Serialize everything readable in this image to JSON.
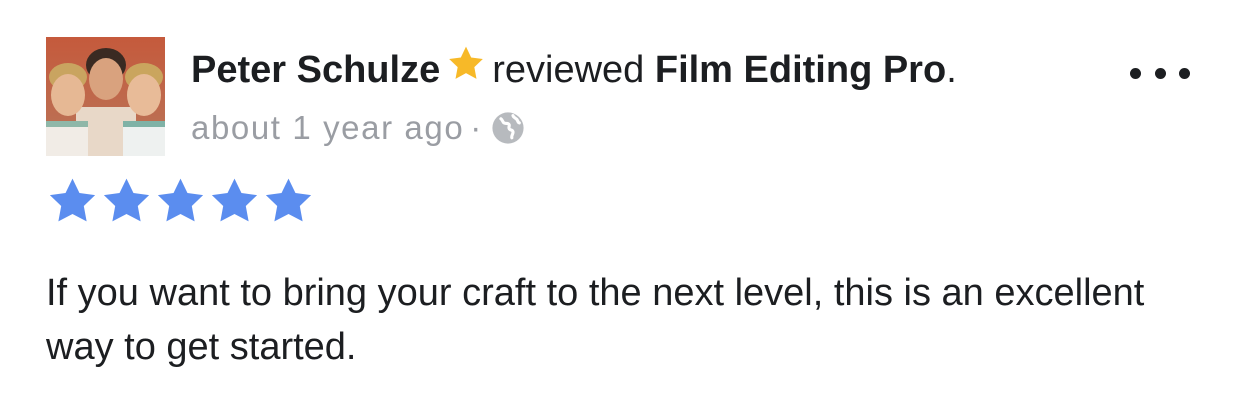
{
  "review": {
    "author": "Peter Schulze",
    "verb": "reviewed",
    "page": "Film Editing Pro",
    "period": ".",
    "timestamp": "about 1 year ago",
    "separator": "·",
    "privacy_icon": "globe-icon",
    "badge_icon": "star-badge-icon",
    "rating": 5,
    "rating_max": 5,
    "text": "If you want to bring your craft to the next level, this is an excellent way to get started."
  },
  "colors": {
    "text": "#1c1e21",
    "meta": "#9a9da3",
    "rating_star": "#5b8def",
    "badge_star": "#f7b928"
  },
  "menu": {
    "icon": "more-options-icon"
  }
}
